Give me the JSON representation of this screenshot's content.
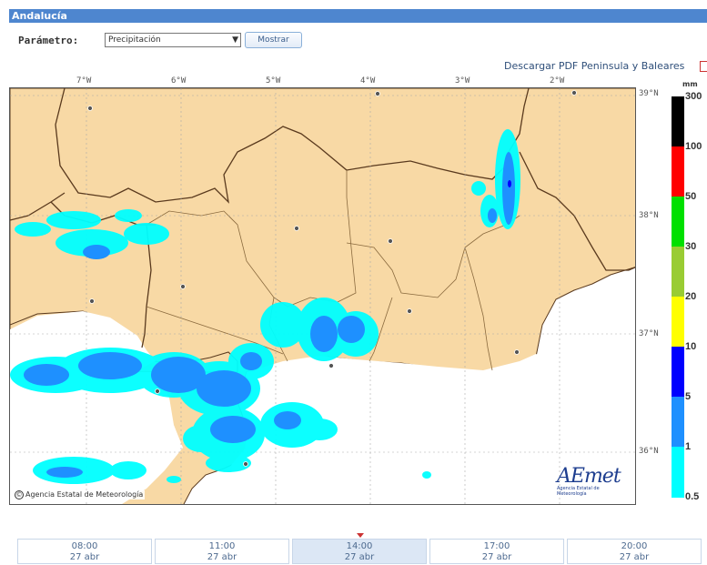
{
  "header": {
    "title": "Andalucía"
  },
  "controls": {
    "param_label": "Parámetro:",
    "param_value": "Precipitación",
    "show_button": "Mostrar",
    "pdf_link": "Descargar PDF Peninsula y Baleares"
  },
  "map": {
    "longitude_labels": [
      "7°W",
      "6°W",
      "5°W",
      "4°W",
      "3°W",
      "2°W"
    ],
    "latitude_labels": [
      "39°N",
      "38°N",
      "37°N",
      "36°N"
    ],
    "credit": "Agencia Estatal de Meteorología",
    "logo_text": "AEmet",
    "logo_subtext": "Agencia Estatal de Meteorología",
    "colors": {
      "land": "#f8d9a5",
      "sea": "#ffffff",
      "border": "#5a3a1e",
      "grid": "#aaaaaa"
    }
  },
  "legend": {
    "unit": "mm",
    "levels": [
      {
        "label": "300",
        "color": "#000000"
      },
      {
        "label": "100",
        "color": "#ff0000"
      },
      {
        "label": "50",
        "color": "#00e000"
      },
      {
        "label": "30",
        "color": "#99cc33"
      },
      {
        "label": "20",
        "color": "#ffff00"
      },
      {
        "label": "10",
        "color": "#0000ff"
      },
      {
        "label": "5",
        "color": "#1e90ff"
      },
      {
        "label": "1",
        "color": "#00ffff"
      },
      {
        "label": "0.5",
        "color": ""
      }
    ]
  },
  "timeline": [
    {
      "time": "08:00",
      "date": "27 abr",
      "active": false
    },
    {
      "time": "11:00",
      "date": "27 abr",
      "active": false
    },
    {
      "time": "14:00",
      "date": "27 abr",
      "active": true
    },
    {
      "time": "17:00",
      "date": "27 abr",
      "active": false
    },
    {
      "time": "20:00",
      "date": "27 abr",
      "active": false
    }
  ]
}
